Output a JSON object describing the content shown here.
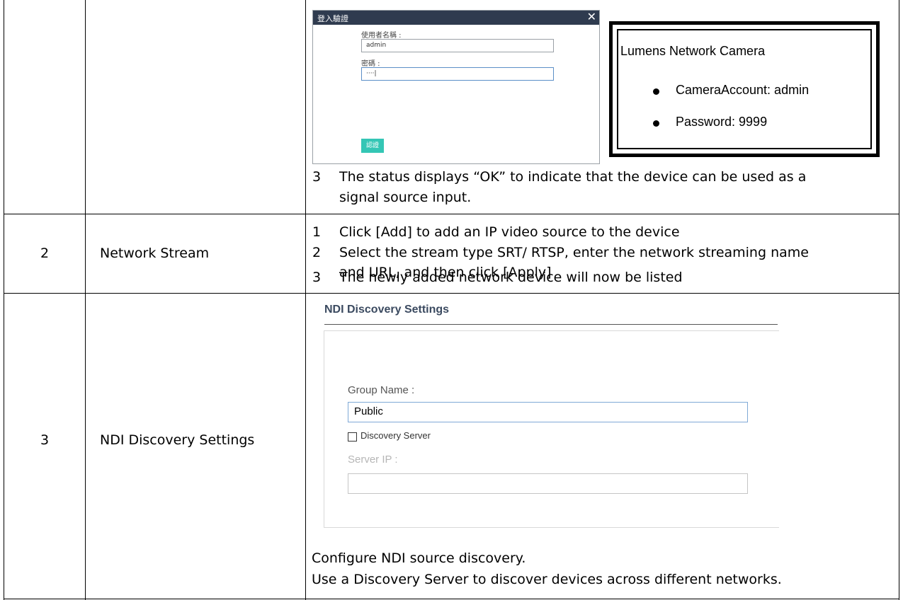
{
  "rows": [
    {
      "steps": [
        {
          "n": "3",
          "line1": "The status displays “OK” to indicate that the device can be used as a",
          "line2": "signal source input."
        }
      ],
      "login_dialog": {
        "title": "登入驗證",
        "close_glyph": "✕",
        "username_label": "使用者名稱 :",
        "username_value": "admin",
        "password_label": "密碼 :",
        "password_value": "····|",
        "submit_label": "認證"
      },
      "info_box": {
        "title": "Lumens Network Camera",
        "items": [
          "CameraAccount: admin",
          "Password: 9999"
        ]
      }
    },
    {
      "number": "2",
      "feature": "Network Stream",
      "steps": [
        {
          "n": "1",
          "line1": "Click [Add] to add an IP video source to the device"
        },
        {
          "n": "2",
          "line1": "Select the stream type SRT/ RTSP, enter the network streaming name",
          "line2": "and URL, and then click [Apply]"
        },
        {
          "n": "3",
          "line1": "The newly added network device will now be listed"
        }
      ]
    },
    {
      "number": "3",
      "feature": "NDI Discovery Settings",
      "ndi_panel": {
        "title": "NDI Discovery Settings",
        "group_name_label": "Group Name :",
        "group_name_value": "Public",
        "checkbox_label": "Discovery Server",
        "server_ip_label": "Server IP :",
        "server_ip_value": ""
      },
      "description": [
        "Configure NDI source discovery.",
        "Use a Discovery Server to discover devices across different networks."
      ]
    }
  ]
}
